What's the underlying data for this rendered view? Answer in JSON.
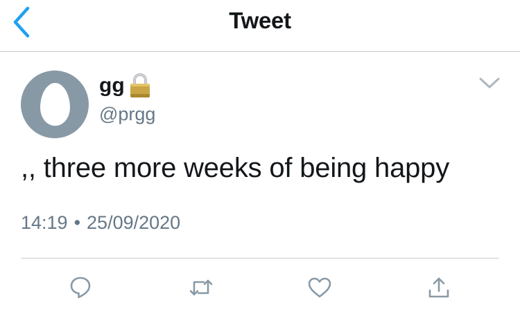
{
  "header": {
    "title": "Tweet",
    "back_icon": "chevron-left-icon",
    "accent_color": "#1DA1F2"
  },
  "author": {
    "display_name": "gg",
    "handle": "@prgg",
    "protected_icon": "lock-icon",
    "avatar": "default-egg-avatar"
  },
  "tweet": {
    "text": ",, three more weeks of being happy",
    "time": "14:19",
    "separator": "•",
    "date": "25/09/2020"
  },
  "actions": [
    {
      "name": "reply",
      "icon": "reply-icon"
    },
    {
      "name": "retweet",
      "icon": "retweet-icon"
    },
    {
      "name": "like",
      "icon": "heart-icon"
    },
    {
      "name": "share",
      "icon": "share-icon"
    }
  ],
  "colors": {
    "text": "#14171A",
    "secondary": "#657786",
    "icon_gray": "#8899A6",
    "divider": "#C8CCD0"
  }
}
